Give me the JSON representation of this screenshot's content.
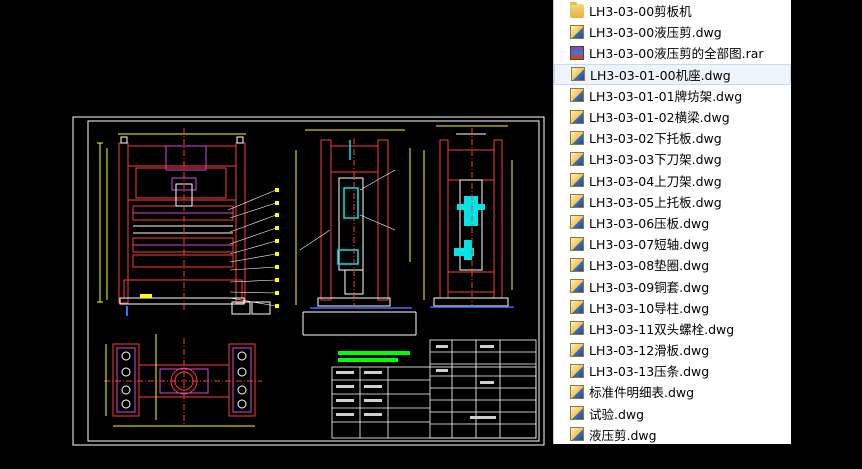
{
  "files": [
    {
      "name": "LH3-03-00剪板机",
      "icon": "folder-icon",
      "selected": false
    },
    {
      "name": "LH3-03-00液压剪.dwg",
      "icon": "dwg-file-icon",
      "selected": false
    },
    {
      "name": "LH3-03-00液压剪的全部图.rar",
      "icon": "rar-archive-icon",
      "selected": false
    },
    {
      "name": "LH3-03-01-00机座.dwg",
      "icon": "dwg-file-icon",
      "selected": true
    },
    {
      "name": "LH3-03-01-01牌坊架.dwg",
      "icon": "dwg-file-icon",
      "selected": false
    },
    {
      "name": "LH3-03-01-02横梁.dwg",
      "icon": "dwg-file-icon",
      "selected": false
    },
    {
      "name": "LH3-03-02下托板.dwg",
      "icon": "dwg-file-icon",
      "selected": false
    },
    {
      "name": "LH3-03-03下刀架.dwg",
      "icon": "dwg-file-icon",
      "selected": false
    },
    {
      "name": "LH3-03-04上刀架.dwg",
      "icon": "dwg-file-icon",
      "selected": false
    },
    {
      "name": "LH3-03-05上托板.dwg",
      "icon": "dwg-file-icon",
      "selected": false
    },
    {
      "name": "LH3-03-06压板.dwg",
      "icon": "dwg-file-icon",
      "selected": false
    },
    {
      "name": "LH3-03-07短轴.dwg",
      "icon": "dwg-file-icon",
      "selected": false
    },
    {
      "name": "LH3-03-08垫圈.dwg",
      "icon": "dwg-file-icon",
      "selected": false
    },
    {
      "name": "LH3-03-09铜套.dwg",
      "icon": "dwg-file-icon",
      "selected": false
    },
    {
      "name": "LH3-03-10导柱.dwg",
      "icon": "dwg-file-icon",
      "selected": false
    },
    {
      "name": "LH3-03-11双头螺栓.dwg",
      "icon": "dwg-file-icon",
      "selected": false
    },
    {
      "name": "LH3-03-12滑板.dwg",
      "icon": "dwg-file-icon",
      "selected": false
    },
    {
      "name": "LH3-03-13压条.dwg",
      "icon": "dwg-file-icon",
      "selected": false
    },
    {
      "name": "标准件明细表.dwg",
      "icon": "dwg-file-icon",
      "selected": false
    },
    {
      "name": "试验.dwg",
      "icon": "dwg-file-icon",
      "selected": false
    },
    {
      "name": "液压剪.dwg",
      "icon": "dwg-file-icon",
      "selected": false
    }
  ],
  "colors": {
    "background": "#000000",
    "frame": "#ffffff",
    "part_red": "#ff3b3b",
    "part_magenta": "#d24bd2",
    "part_cyan": "#00e5e5",
    "dim_yellow": "#ffff00",
    "line_green": "#00ff00",
    "line_blue": "#3a6cff"
  }
}
